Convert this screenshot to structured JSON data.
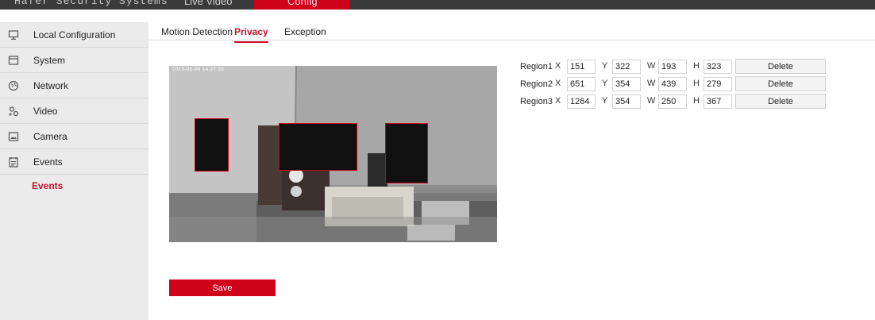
{
  "header": {
    "brand": "Hafer Security Systems",
    "nav": [
      {
        "label": "Live Video"
      },
      {
        "label": "Config"
      }
    ]
  },
  "sidebar": {
    "items": [
      {
        "label": "Local Configuration",
        "icon": "monitor-icon"
      },
      {
        "label": "System",
        "icon": "system-icon"
      },
      {
        "label": "Network",
        "icon": "globe-icon"
      },
      {
        "label": "Video",
        "icon": "video-icon"
      },
      {
        "label": "Camera",
        "icon": "image-icon"
      },
      {
        "label": "Events",
        "icon": "events-icon"
      }
    ],
    "active_sub": "Events"
  },
  "tabs": [
    {
      "label": "Motion Detection"
    },
    {
      "label": "Privacy",
      "active": true
    },
    {
      "label": "Exception"
    }
  ],
  "preview": {
    "osd": "2019-05-06 14:27:33"
  },
  "regions": [
    {
      "name": "Region1",
      "x": "151",
      "y": "322",
      "w": "193",
      "h": "323",
      "delete_label": "Delete"
    },
    {
      "name": "Region2",
      "x": "651",
      "y": "354",
      "w": "439",
      "h": "279",
      "delete_label": "Delete"
    },
    {
      "name": "Region3",
      "x": "1264",
      "y": "354",
      "w": "250",
      "h": "367",
      "delete_label": "Delete"
    }
  ],
  "labels": {
    "x": "X",
    "y": "Y",
    "w": "W",
    "h": "H"
  },
  "save_label": "Save",
  "colors": {
    "accent": "#d0021b",
    "sidebar_bg": "#ebebeb",
    "topbar_bg": "#3a3a3a"
  }
}
